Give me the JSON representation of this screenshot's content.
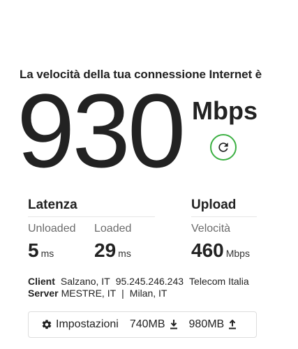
{
  "header": {
    "headline": "La velocità della tua connessione Internet è"
  },
  "speed": {
    "value": "930",
    "unit": "Mbps",
    "refresh_icon": "refresh-icon",
    "accent_color": "#3cb043"
  },
  "latency": {
    "title": "Latenza",
    "unloaded": {
      "label": "Unloaded",
      "value": "5",
      "unit": "ms"
    },
    "loaded": {
      "label": "Loaded",
      "value": "29",
      "unit": "ms"
    }
  },
  "upload": {
    "title": "Upload",
    "speed": {
      "label": "Velocità",
      "value": "460",
      "unit": "Mbps"
    }
  },
  "client": {
    "label": "Client",
    "location": "Salzano, IT",
    "ip": "95.245.246.243",
    "isp": "Telecom Italia"
  },
  "server": {
    "label": "Server",
    "location": "MESTRE, IT",
    "separator": "|",
    "location2": "Milan, IT"
  },
  "settings": {
    "icon": "gear-icon",
    "label": "Impostazioni",
    "download_amount": "740MB",
    "download_icon": "download-icon",
    "upload_amount": "980MB",
    "upload_icon": "upload-icon"
  }
}
